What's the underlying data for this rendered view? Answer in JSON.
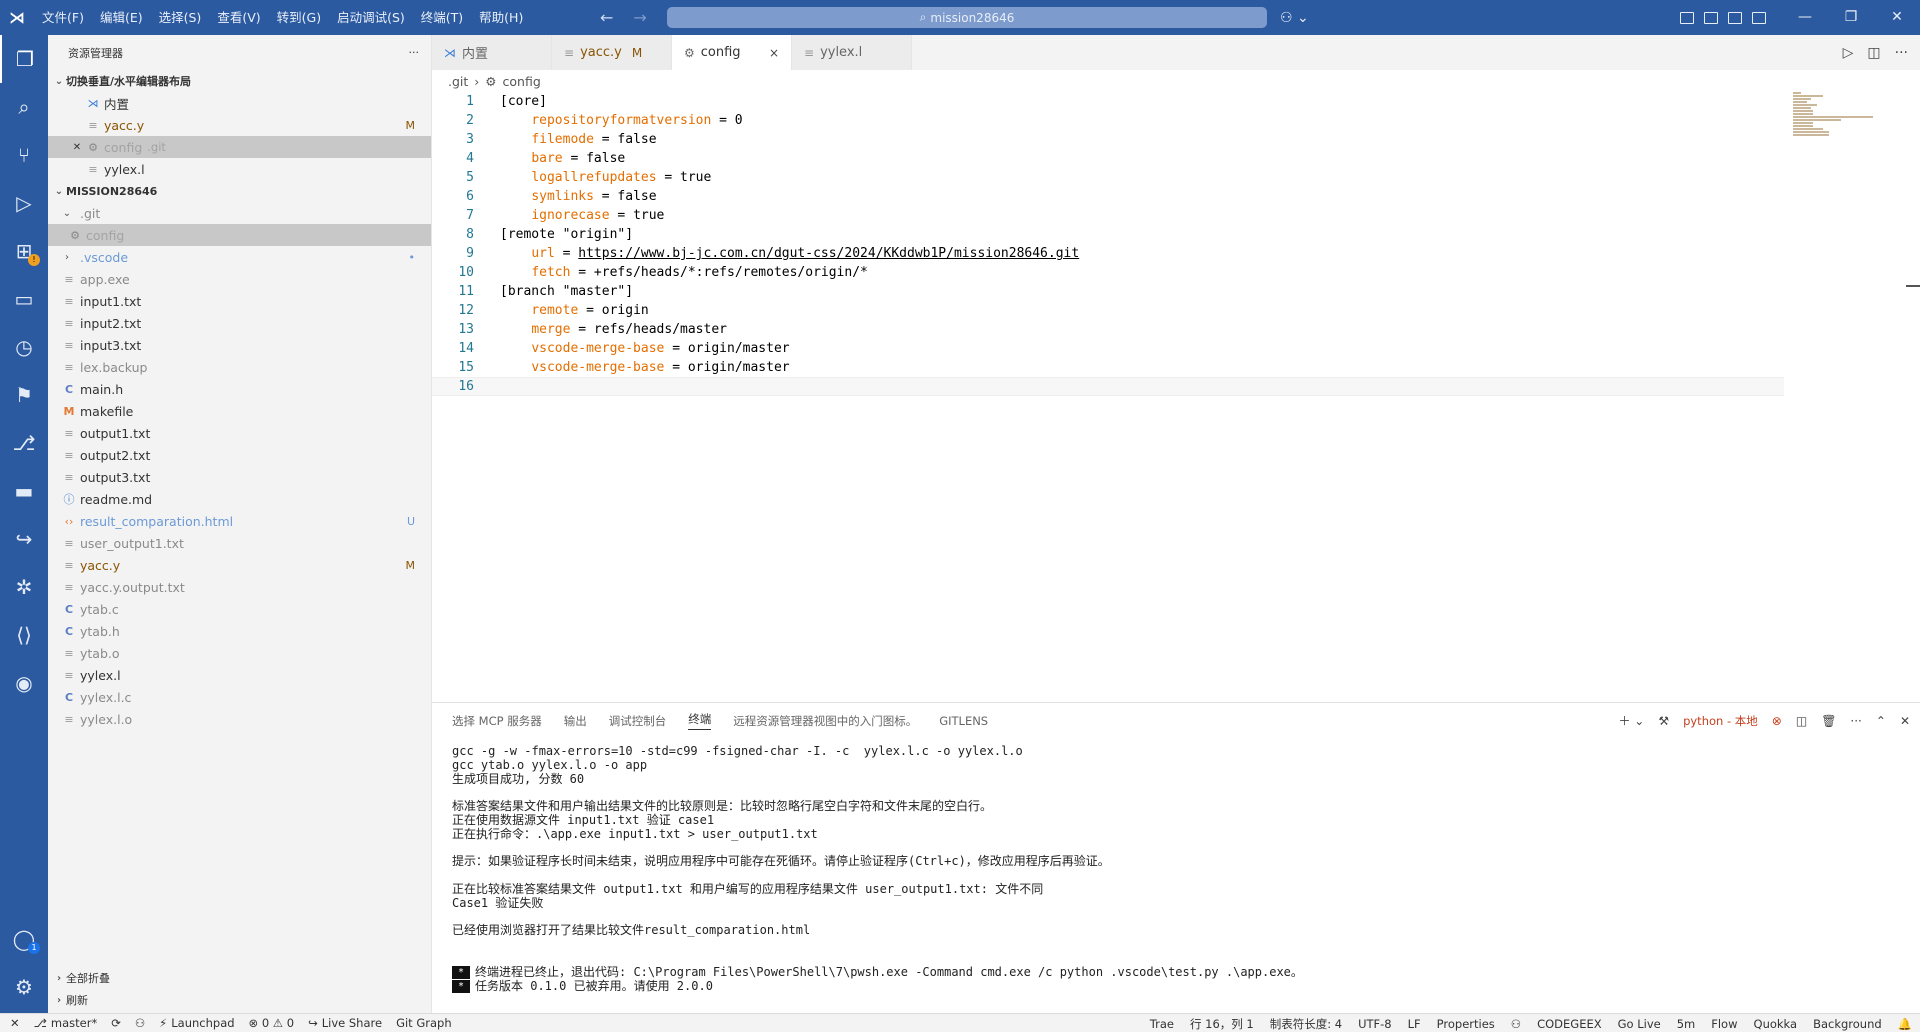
{
  "titlebar": {
    "menus": [
      "文件(F)",
      "编辑(E)",
      "选择(S)",
      "查看(V)",
      "转到(G)",
      "启动调试(S)",
      "终端(T)",
      "帮助(H)"
    ],
    "command_center": "mission28646"
  },
  "activitybar": {
    "icons": [
      "explorer-icon",
      "search-icon",
      "source-control-icon",
      "run-debug-icon",
      "extensions-icon",
      "remote-explorer-icon",
      "timeline-icon",
      "bookmarks-icon",
      "git-graph-icon",
      "panel-icon",
      "live-share-icon",
      "paw-icon",
      "code-icon",
      "github-icon",
      "accounts-icon",
      "settings-icon"
    ],
    "accounts_badge": "1",
    "extensions_badge": "!"
  },
  "sidebar": {
    "title": "资源管理器",
    "more": "···",
    "open_editors_label": "切换垂直/水平编辑器布局",
    "open_editors": [
      {
        "name": "内置",
        "detail": "",
        "icon": "vs",
        "decoration": ""
      },
      {
        "name": "yacc.y",
        "detail": "",
        "icon": "txt",
        "decoration": "M"
      },
      {
        "name": "config",
        "detail": ".git",
        "icon": "gear",
        "decoration": ""
      },
      {
        "name": "yylex.l",
        "detail": "",
        "icon": "txt",
        "decoration": ""
      }
    ],
    "project_label": "MISSION28646",
    "git_folder": ".git",
    "git_config": "config",
    "files": [
      {
        "name": ".vscode",
        "type": "folder",
        "icon": "",
        "decoration": "•"
      },
      {
        "name": "app.exe",
        "type": "file",
        "icon": "txt",
        "decoration": ""
      },
      {
        "name": "input1.txt",
        "type": "file",
        "icon": "txt",
        "decoration": ""
      },
      {
        "name": "input2.txt",
        "type": "file",
        "icon": "txt",
        "decoration": ""
      },
      {
        "name": "input3.txt",
        "type": "file",
        "icon": "txt",
        "decoration": ""
      },
      {
        "name": "lex.backup",
        "type": "file",
        "icon": "txt",
        "decoration": ""
      },
      {
        "name": "main.h",
        "type": "file",
        "icon": "c",
        "decoration": ""
      },
      {
        "name": "makefile",
        "type": "file",
        "icon": "m",
        "decoration": ""
      },
      {
        "name": "output1.txt",
        "type": "file",
        "icon": "txt",
        "decoration": ""
      },
      {
        "name": "output2.txt",
        "type": "file",
        "icon": "txt",
        "decoration": ""
      },
      {
        "name": "output3.txt",
        "type": "file",
        "icon": "txt",
        "decoration": ""
      },
      {
        "name": "readme.md",
        "type": "file",
        "icon": "info",
        "decoration": ""
      },
      {
        "name": "result_comparation.html",
        "type": "file",
        "icon": "html",
        "decoration": "U"
      },
      {
        "name": "user_output1.txt",
        "type": "file",
        "icon": "txt",
        "decoration": ""
      },
      {
        "name": "yacc.y",
        "type": "file",
        "icon": "txt",
        "decoration": "M"
      },
      {
        "name": "yacc.y.output.txt",
        "type": "file",
        "icon": "txt",
        "decoration": ""
      },
      {
        "name": "ytab.c",
        "type": "file",
        "icon": "c",
        "decoration": ""
      },
      {
        "name": "ytab.h",
        "type": "file",
        "icon": "c",
        "decoration": ""
      },
      {
        "name": "ytab.o",
        "type": "file",
        "icon": "txt",
        "decoration": ""
      },
      {
        "name": "yylex.l",
        "type": "file",
        "icon": "txt",
        "decoration": ""
      },
      {
        "name": "yylex.l.c",
        "type": "file",
        "icon": "c",
        "decoration": ""
      },
      {
        "name": "yylex.l.o",
        "type": "file",
        "icon": "txt",
        "decoration": ""
      }
    ],
    "collapse_all": "全部折叠",
    "refresh": "刷新"
  },
  "tabs": [
    {
      "label": "内置",
      "icon": "vs",
      "decoration": ""
    },
    {
      "label": "yacc.y",
      "icon": "txt",
      "decoration": "M"
    },
    {
      "label": "config",
      "icon": "gear",
      "decoration": "×"
    },
    {
      "label": "yylex.l",
      "icon": "txt",
      "decoration": ""
    }
  ],
  "breadcrumb": {
    "folder": ".git",
    "file": "config"
  },
  "code_lines": [
    {
      "n": "1",
      "parts": [
        [
          "sec",
          "[core]"
        ]
      ]
    },
    {
      "n": "2",
      "parts": [
        [
          "",
          "    "
        ],
        [
          "k",
          "repositoryformatversion"
        ],
        [
          "",
          " = 0"
        ]
      ]
    },
    {
      "n": "3",
      "parts": [
        [
          "",
          "    "
        ],
        [
          "k",
          "filemode"
        ],
        [
          "",
          " = false"
        ]
      ]
    },
    {
      "n": "4",
      "parts": [
        [
          "",
          "    "
        ],
        [
          "k",
          "bare"
        ],
        [
          "",
          " = false"
        ]
      ]
    },
    {
      "n": "5",
      "parts": [
        [
          "",
          "    "
        ],
        [
          "k",
          "logallrefupdates"
        ],
        [
          "",
          " = true"
        ]
      ]
    },
    {
      "n": "6",
      "parts": [
        [
          "",
          "    "
        ],
        [
          "k",
          "symlinks"
        ],
        [
          "",
          " = false"
        ]
      ]
    },
    {
      "n": "7",
      "parts": [
        [
          "",
          "    "
        ],
        [
          "k",
          "ignorecase"
        ],
        [
          "",
          " = true"
        ]
      ]
    },
    {
      "n": "8",
      "parts": [
        [
          "sec",
          "[remote \"origin\"]"
        ]
      ]
    },
    {
      "n": "9",
      "parts": [
        [
          "",
          "    "
        ],
        [
          "k",
          "url"
        ],
        [
          "",
          " = "
        ],
        [
          "lnk",
          "https://www.bj-jc.com.cn/dgut-css/2024/KKddwb1P/mission28646.git"
        ]
      ]
    },
    {
      "n": "10",
      "parts": [
        [
          "",
          "    "
        ],
        [
          "k",
          "fetch"
        ],
        [
          "",
          " = +refs/heads/*:refs/remotes/origin/*"
        ]
      ]
    },
    {
      "n": "11",
      "parts": [
        [
          "sec",
          "[branch \"master\"]"
        ]
      ]
    },
    {
      "n": "12",
      "parts": [
        [
          "",
          "    "
        ],
        [
          "k",
          "remote"
        ],
        [
          "",
          " = origin"
        ]
      ]
    },
    {
      "n": "13",
      "parts": [
        [
          "",
          "    "
        ],
        [
          "k",
          "merge"
        ],
        [
          "",
          " = refs/heads/master"
        ]
      ]
    },
    {
      "n": "14",
      "parts": [
        [
          "",
          "    "
        ],
        [
          "k",
          "vscode-merge-base"
        ],
        [
          "",
          " = origin/master"
        ]
      ]
    },
    {
      "n": "15",
      "parts": [
        [
          "",
          "    "
        ],
        [
          "k",
          "vscode-merge-base"
        ],
        [
          "",
          " = origin/master"
        ]
      ]
    },
    {
      "n": "16",
      "parts": [
        [
          "",
          ""
        ]
      ]
    }
  ],
  "panel": {
    "tabs": [
      "选择 MCP 服务器",
      "输出",
      "调试控制台",
      "终端",
      "远程资源管理器视图中的入门图标。",
      "GITLENS"
    ],
    "active_tab": "终端",
    "terminal_name": "python - 本地",
    "terminal_lines": [
      "gcc -g -w -fmax-errors=10 -std=c99 -fsigned-char -I. -c  yylex.l.c -o yylex.l.o",
      "gcc ytab.o yylex.l.o -o app",
      "生成项目成功, 分数 60",
      "",
      "标准答案结果文件和用户输出结果文件的比较原则是：比较时忽略行尾空白字符和文件末尾的空白行。",
      "正在使用数据源文件 input1.txt 验证 case1",
      "正在执行命令：.\\app.exe input1.txt > user_output1.txt",
      "",
      "提示：如果验证程序长时间未结束，说明应用程序中可能存在死循环。请停止验证程序(Ctrl+c)，修改应用程序后再验证。",
      "",
      "正在比较标准答案结果文件 output1.txt 和用户编写的应用程序结果文件 user_output1.txt: 文件不同",
      "Case1 验证失败",
      "",
      "已经使用浏览器打开了结果比较文件result_comparation.html",
      "",
      ""
    ],
    "terminal_final": [
      "终端进程已终止，退出代码: C:\\Program Files\\PowerShell\\7\\pwsh.exe -Command cmd.exe /c python .vscode\\test.py .\\app.exe。",
      "任务版本 0.1.0 已被弃用。请使用 2.0.0"
    ]
  },
  "statusbar": {
    "left": [
      "✕",
      "master*",
      "⟳",
      "",
      "Launchpad",
      "⊗ 0 ⚠ 0",
      "Live Share",
      "Git Graph"
    ],
    "right": [
      "Trae",
      "行 16，列 1",
      "制表符长度: 4",
      "UTF-8",
      "LF",
      "Properties",
      "",
      "CODEGEEX",
      "Go Live",
      "5m",
      "Flow",
      "Quokka",
      "Background"
    ]
  }
}
